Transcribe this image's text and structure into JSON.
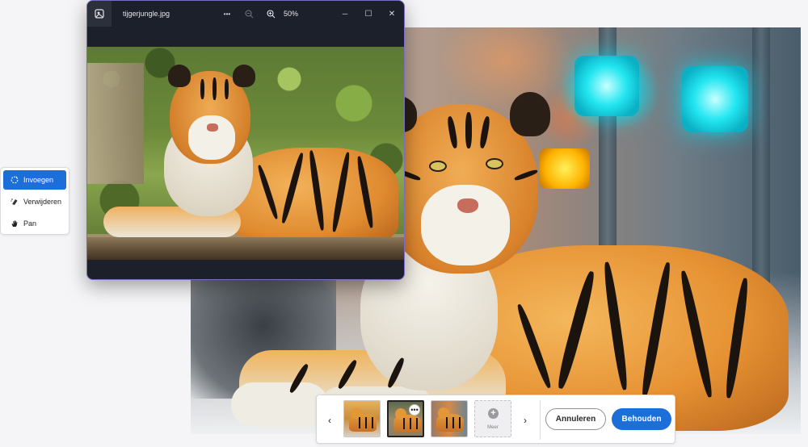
{
  "window": {
    "file_name": "tijgerjungle.jpg",
    "more_label": "•••",
    "zoom_out_icon": "zoom-out-icon",
    "zoom_in_icon": "zoom-in-icon",
    "zoom_level": "50%",
    "minimize_glyph": "─",
    "maximize_glyph": "☐",
    "close_glyph": "✕"
  },
  "tools": {
    "items": [
      {
        "label": "Invoegen",
        "icon": "insert-icon",
        "active": true
      },
      {
        "label": "Verwijderen",
        "icon": "eraser-icon",
        "active": false
      },
      {
        "label": "Pan",
        "icon": "hand-icon",
        "active": false
      }
    ]
  },
  "variations": {
    "prev_glyph": "‹",
    "next_glyph": "›",
    "more_label": "Meer",
    "thumbnail_more_glyph": "•••",
    "selected_index": 1
  },
  "actions": {
    "cancel_label": "Annuleren",
    "keep_label": "Behouden"
  },
  "colors": {
    "accent": "#1c6fd9",
    "window_bg": "#1c202a",
    "window_border": "#7c6cc4"
  }
}
